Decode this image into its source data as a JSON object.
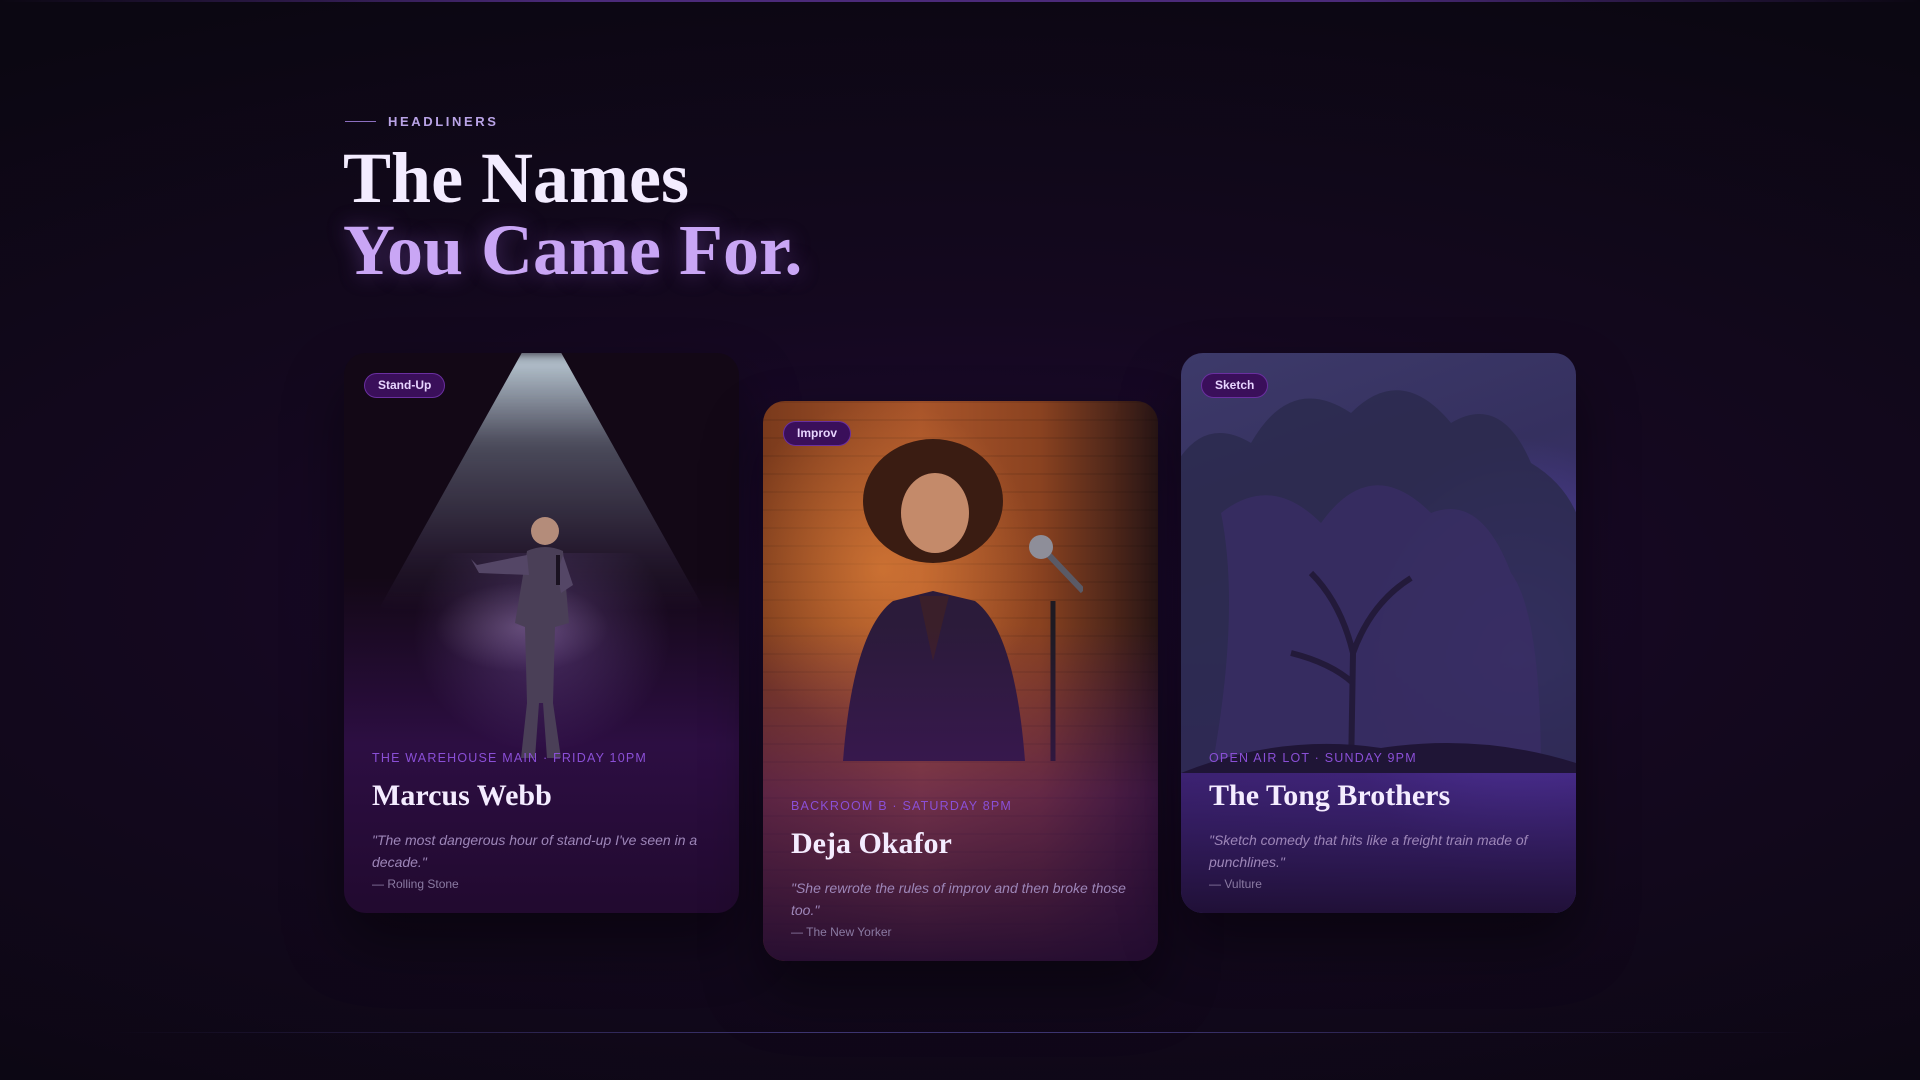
{
  "section": {
    "eyebrow": "HEADLINERS",
    "title_line1": "The Names",
    "title_line2": "You Came For."
  },
  "cards": [
    {
      "tag": "Stand-Up",
      "meta": "THE WAREHOUSE MAIN · FRIDAY 10PM",
      "name": "Marcus Webb",
      "quote": "\"The most dangerous hour of stand-up I've seen in a decade.\"",
      "source": "— Rolling Stone"
    },
    {
      "tag": "Improv",
      "meta": "BACKROOM B · SATURDAY 8PM",
      "name": "Deja Okafor",
      "quote": "\"She rewrote the rules of improv and then broke those too.\"",
      "source": "— The New Yorker"
    },
    {
      "tag": "Sketch",
      "meta": "OPEN AIR LOT · SUNDAY 9PM",
      "name": "The Tong Brothers",
      "quote": "\"Sketch comedy that hits like a freight train made of punchlines.\"",
      "source": "— Vulture"
    }
  ],
  "colors": {
    "background": "#14081f",
    "accent": "#c9a6f5",
    "badge": "#3a0f5a",
    "meta": "#8a4fd6"
  }
}
